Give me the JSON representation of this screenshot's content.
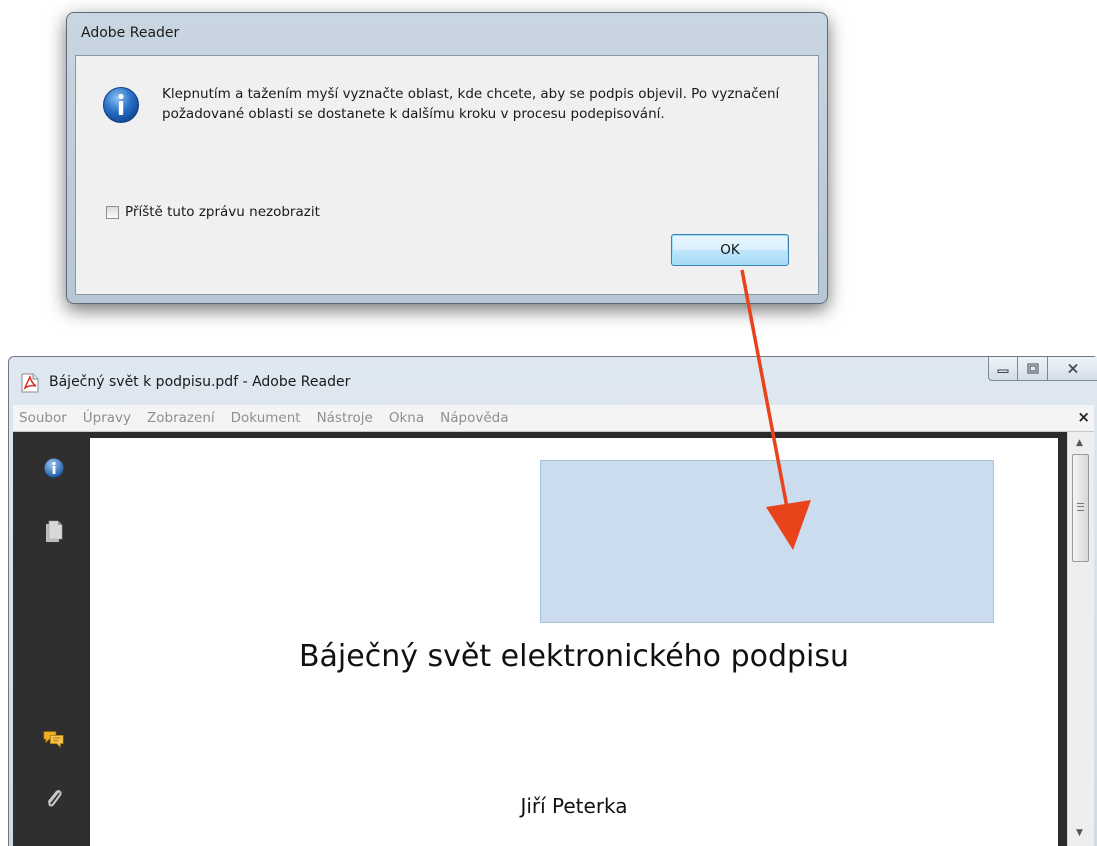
{
  "dialog": {
    "title": "Adobe Reader",
    "message": "Klepnutím a tažením myší vyznačte oblast, kde chcete, aby se podpis objevil. Po vyznačení požadované oblasti se dostanete k dalšímu kroku v procesu podepisování.",
    "checkbox_label": "Příště tuto zprávu nezobrazit",
    "checkbox_checked": false,
    "ok_label": "OK",
    "icon": "info-icon"
  },
  "window": {
    "title": "Báječný svět k podpisu.pdf - Adobe Reader",
    "icon": "pdf-icon",
    "controls": {
      "minimize": "minimize-icon",
      "maximize": "maximize-icon",
      "close": "close-icon"
    }
  },
  "menu": {
    "items": [
      "Soubor",
      "Úpravy",
      "Zobrazení",
      "Dokument",
      "Nástroje",
      "Okna",
      "Nápověda"
    ],
    "close_glyph": "×"
  },
  "sidebar": {
    "icons": [
      "document-info-icon",
      "pages-icon",
      "comments-icon",
      "attachments-icon"
    ]
  },
  "document": {
    "title": "Báječný svět elektronického podpisu",
    "author": "Jiří Peterka",
    "signature_area_color": "#cadced"
  },
  "annotation": {
    "arrow_color": "#e8431a"
  }
}
